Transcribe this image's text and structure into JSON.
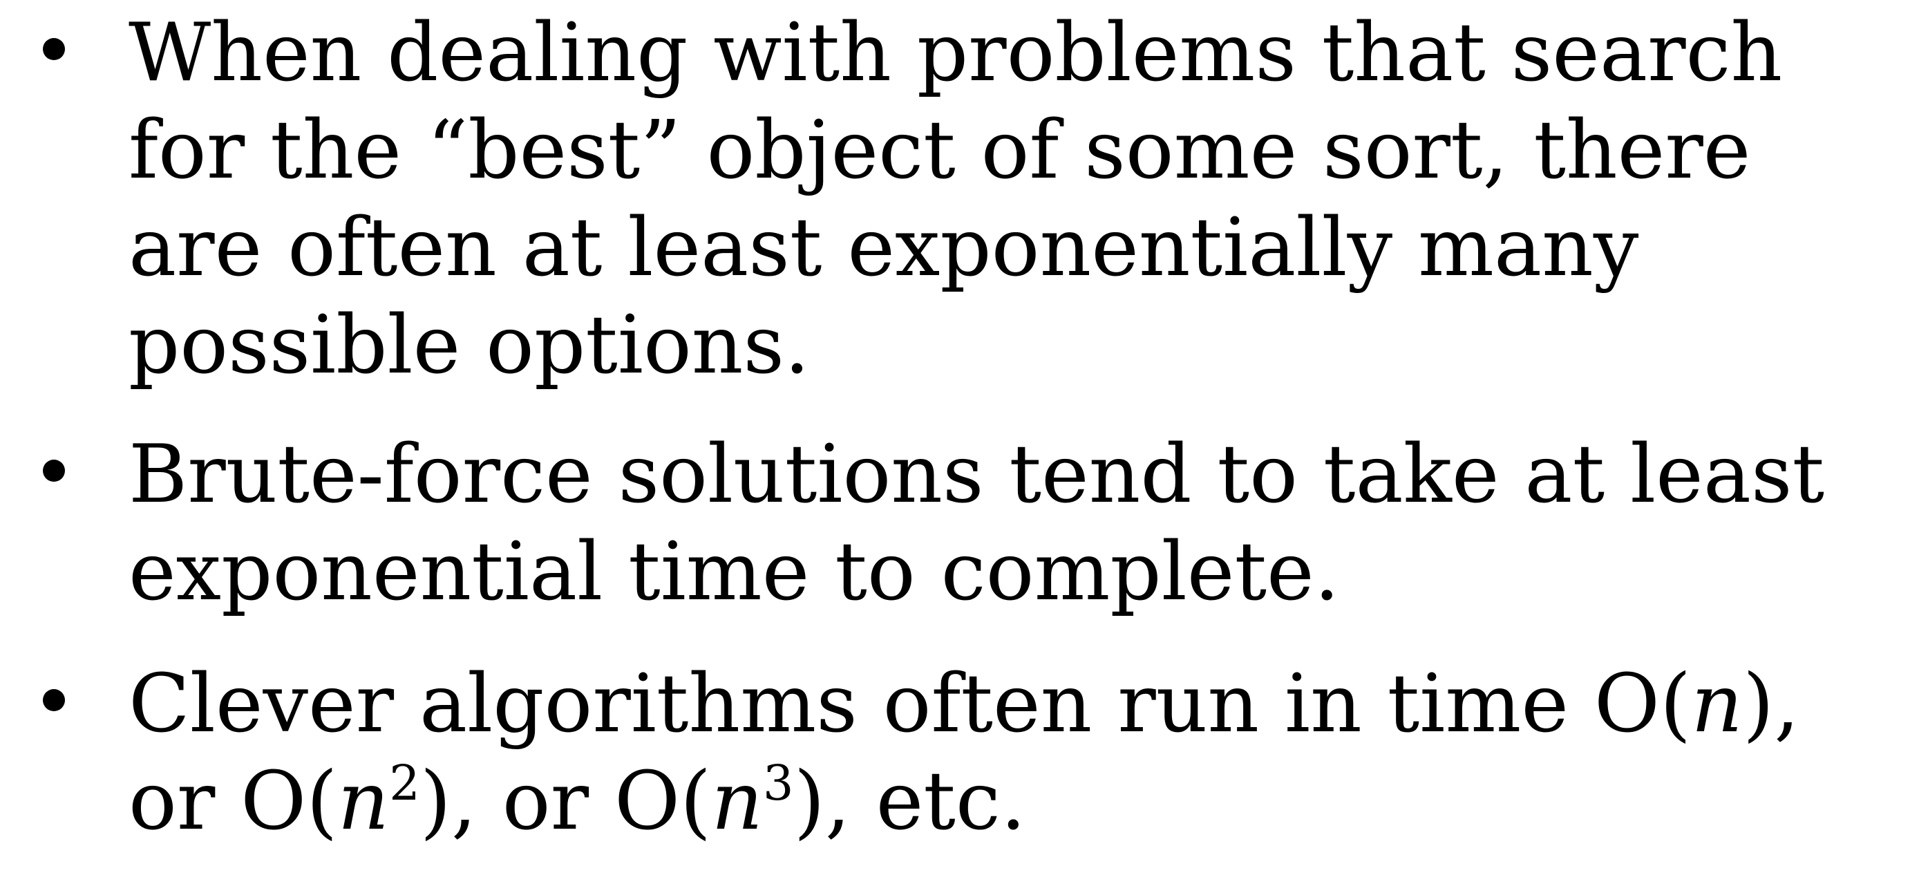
{
  "bullets": [
    {
      "lines": [
        "When dealing with problems that search",
        "for the “best” object of some sort, there",
        "are often at least exponentially many",
        "possible options."
      ]
    },
    {
      "lines": [
        "Brute-force solutions tend to take at least",
        "exponential time to complete."
      ]
    },
    {
      "line1": {
        "prefix": "Clever algorithms often run in time O(",
        "var": "n",
        "suffix": "),"
      },
      "line2": {
        "part1": "or O(",
        "var1": "n",
        "exp1": "2",
        "part2": "), or O(",
        "var2": "n",
        "exp2": "3",
        "part3": "), etc."
      }
    }
  ]
}
